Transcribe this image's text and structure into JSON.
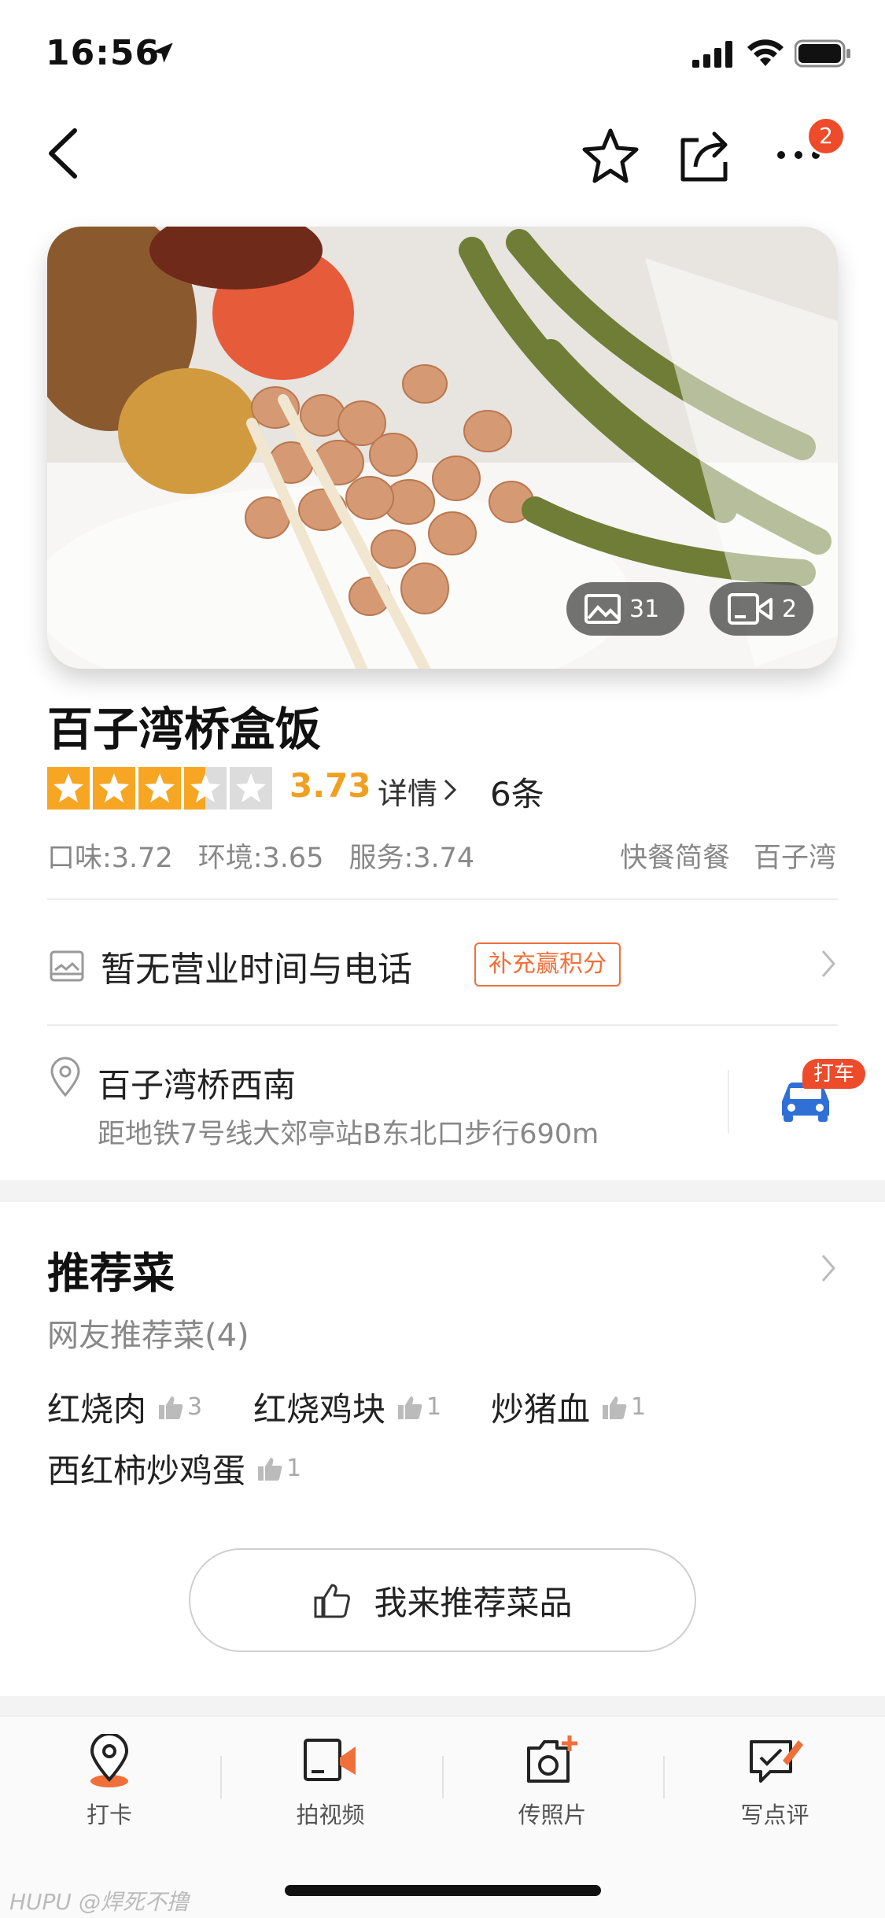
{
  "status": {
    "time": "16:56"
  },
  "nav": {
    "badge": "2"
  },
  "hero": {
    "photo_count": "31",
    "video_count": "2"
  },
  "shop": {
    "name": "百子湾桥盒饭",
    "score": "3.73",
    "detail_label": "详情",
    "review_count": "6条",
    "subscores": [
      "口味:3.72",
      "环境:3.65",
      "服务:3.74"
    ],
    "tags": [
      "快餐简餐",
      "百子湾"
    ],
    "hours_text": "暂无营业时间与电话",
    "bonus_label": "补充赢积分",
    "address": "百子湾桥西南",
    "distance": "距地铁7号线大郊亭站B东北口步行690m",
    "taxi_label": "打车"
  },
  "recommend": {
    "title": "推荐菜",
    "subtitle": "网友推荐菜(4)",
    "dishes": [
      {
        "name": "红烧肉",
        "likes": "3"
      },
      {
        "name": "红烧鸡块",
        "likes": "1"
      },
      {
        "name": "炒猪血",
        "likes": "1"
      },
      {
        "name": "西红柿炒鸡蛋",
        "likes": "1"
      }
    ],
    "button_label": "我来推荐菜品"
  },
  "tabbar": {
    "items": [
      {
        "label": "打卡",
        "icon": "location-pin-icon"
      },
      {
        "label": "拍视频",
        "icon": "video-camera-icon"
      },
      {
        "label": "传照片",
        "icon": "camera-plus-icon"
      },
      {
        "label": "写点评",
        "icon": "write-review-icon"
      }
    ]
  },
  "watermark": "HUPU @焊死不撸",
  "colors": {
    "accent": "#f6a623",
    "orange": "#f0703a",
    "red": "#ee4b2b",
    "car_blue": "#2f6fd6"
  }
}
